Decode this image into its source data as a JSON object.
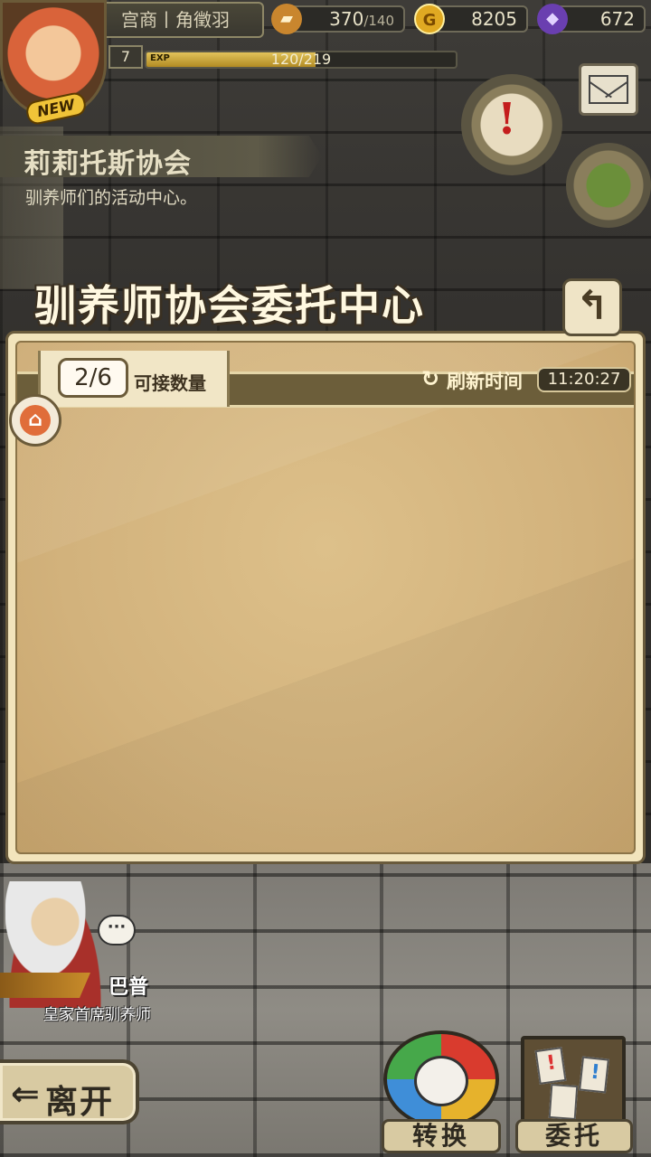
{
  "topbar": {
    "player_name": "宫商丨角徵羽",
    "level": "7",
    "exp_label": "EXP",
    "exp_text": "120/219",
    "exp_fraction": 0.548,
    "stamina_current": "370",
    "stamina_max": "/140",
    "gold": "8205",
    "gems": "672",
    "avatar_badge": "NEW"
  },
  "location": {
    "title": "莉莉托斯协会",
    "subtitle": "驯养师们的活动中心。"
  },
  "panel": {
    "title": "驯养师协会委托中心",
    "back_icon": "↰",
    "count_value": "2/6",
    "count_label": "可接数量",
    "refresh_icon": "↻",
    "refresh_label": "刷新时间",
    "refresh_time": "11:20:27"
  },
  "npc": {
    "name": "巴普",
    "title": "皇家首席驯养师",
    "chat_glyph": "···"
  },
  "bottom": {
    "leave_arrow": "⇐",
    "leave_label": "离开",
    "convert_label": "转换",
    "commission_label": "委托"
  },
  "icons": {
    "stamina": "bread-icon",
    "gold": "gold-coin-icon",
    "gems": "purple-gem-icon",
    "quest": "quest-scroll-icon",
    "mail": "mail-icon",
    "bag": "bag-icon",
    "sort": "sort-icon"
  }
}
